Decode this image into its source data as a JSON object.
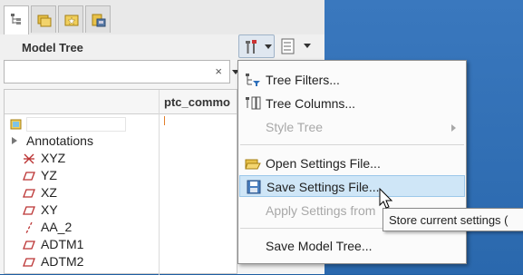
{
  "model_tree": {
    "title": "Model Tree",
    "column_header": "ptc_commo",
    "search": {
      "value": "",
      "clear_glyph": "×"
    },
    "tree_items": [
      {
        "label": "Annotations",
        "icon": "expander-arrow-icon"
      },
      {
        "label": "XYZ",
        "icon": "csys-icon"
      },
      {
        "label": "YZ",
        "icon": "datum-plane-icon"
      },
      {
        "label": "XZ",
        "icon": "datum-plane-icon"
      },
      {
        "label": "XY",
        "icon": "datum-plane-icon"
      },
      {
        "label": "AA_2",
        "icon": "datum-axis-icon"
      },
      {
        "label": "ADTM1",
        "icon": "datum-plane-icon"
      },
      {
        "label": "ADTM2",
        "icon": "datum-plane-icon"
      }
    ]
  },
  "menu": {
    "items": [
      {
        "label": "Tree Filters...",
        "enabled": true
      },
      {
        "label": "Tree Columns...",
        "enabled": true
      },
      {
        "label": "Style Tree",
        "enabled": false
      },
      {
        "label": "Open Settings File...",
        "enabled": true
      },
      {
        "label": "Save Settings File...",
        "enabled": true,
        "hover": true
      },
      {
        "label": "Apply Settings from",
        "enabled": false
      },
      {
        "label": "Save Model Tree...",
        "enabled": true
      }
    ]
  },
  "tooltip": {
    "text": "Store current settings ("
  },
  "colors": {
    "right_bg": "#2a68ad",
    "hover": "#cfe6f7",
    "accent_orange": "#e27e2a"
  }
}
